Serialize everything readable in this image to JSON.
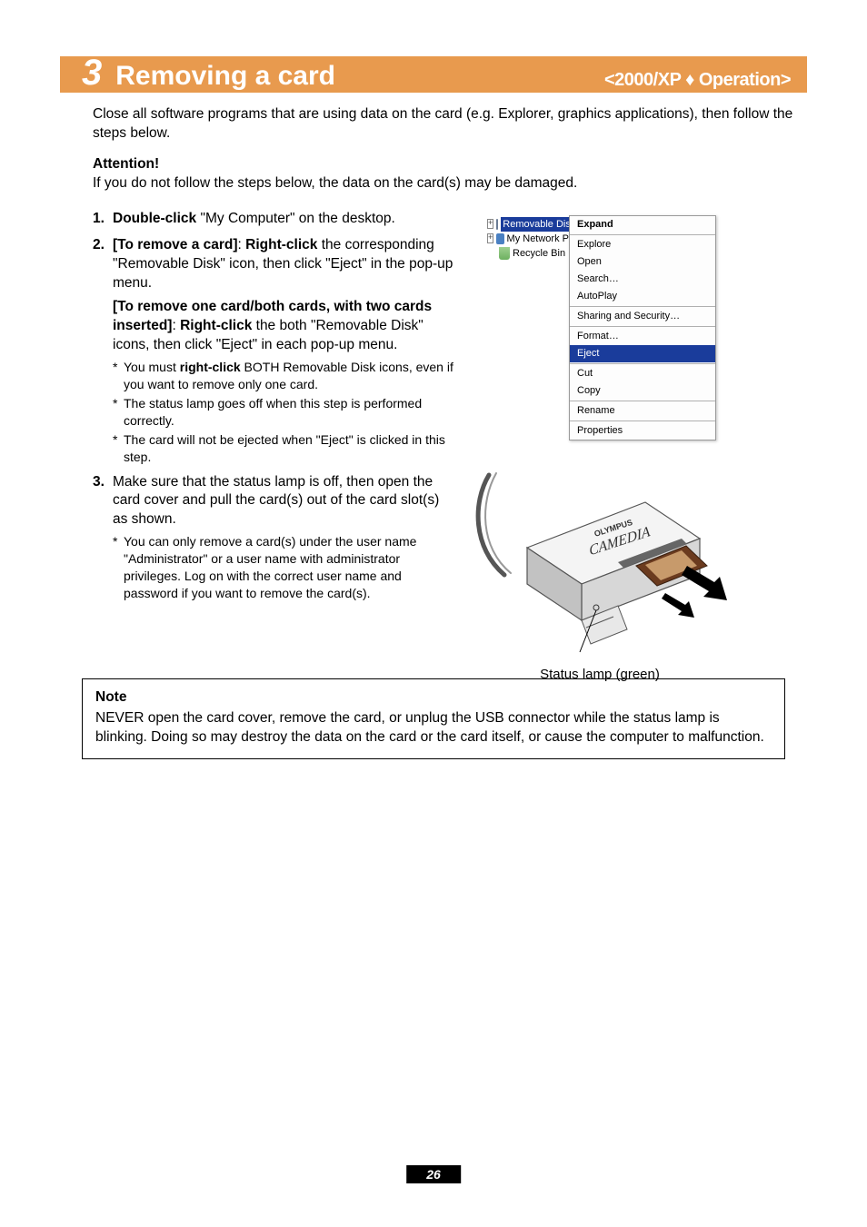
{
  "banner": {
    "number": "3",
    "title": "Removing a card",
    "right": "<2000/XP ♦ Operation>"
  },
  "intro": "Close all software programs that are using data on the card (e.g. Explorer, graphics applications), then follow the steps below.",
  "attention": {
    "heading": "Attention!",
    "text": "If you do not follow the steps below, the data on the card(s) may be damaged."
  },
  "steps": {
    "s1": {
      "bold": "Double-click",
      "rest": " \"My Computer\" on the desktop."
    },
    "s2": {
      "lead_bold1": "[To remove a card]",
      "lead_sep": ": ",
      "lead_bold2": "Right-click",
      "lead_rest": " the corresponding \"Removable Disk\" icon, then click \"Eject\" in the pop-up menu.",
      "sub_bold1": "[To remove one card/both cards, with two cards inserted]",
      "sub_sep": ": ",
      "sub_bold2": "Right-click",
      "sub_rest": " the both \"Removable Disk\" icons, then click \"Eject\" in each pop-up menu.",
      "stars": [
        {
          "pre": "You must ",
          "bold": "right-click",
          "post": " BOTH Removable Disk icons, even if you want to remove only one card."
        },
        {
          "pre": "The status lamp goes off when this step is performed correctly.",
          "bold": "",
          "post": ""
        },
        {
          "pre": "The card will not be ejected when \"Eject\" is clicked in this step.",
          "bold": "",
          "post": ""
        }
      ]
    },
    "s3": {
      "text": "Make sure that the status lamp is off, then open the card cover and pull the card(s) out of the card slot(s) as shown.",
      "stars": [
        {
          "pre": "You can only remove a card(s) under the user name \"Administrator\" or a user name with administrator privileges. Log on with the correct user name and password if you want to remove the card(s).",
          "bold": "",
          "post": ""
        }
      ]
    }
  },
  "tree": {
    "removable": "Removable Disk (…)",
    "network": "My Network P",
    "recycle": "Recycle Bin"
  },
  "context_menu": [
    {
      "label": "Expand",
      "bold": true
    },
    {
      "sep": true
    },
    {
      "label": "Explore"
    },
    {
      "label": "Open"
    },
    {
      "label": "Search…"
    },
    {
      "label": "AutoPlay"
    },
    {
      "sep": true
    },
    {
      "label": "Sharing and Security…"
    },
    {
      "sep": true
    },
    {
      "label": "Format…"
    },
    {
      "label": "Eject",
      "highlight": true
    },
    {
      "sep": true
    },
    {
      "label": "Cut"
    },
    {
      "label": "Copy"
    },
    {
      "sep": true
    },
    {
      "label": "Rename"
    },
    {
      "sep": true
    },
    {
      "label": "Properties"
    }
  ],
  "device": {
    "brand1": "OLYMPUS",
    "brand2": "CAMEDIA",
    "caption": "Status lamp (green)"
  },
  "note": {
    "heading": "Note",
    "text": "NEVER open the card cover, remove the card, or unplug the USB connector while the status lamp is blinking. Doing so may destroy the data on the card or the card itself, or cause the computer to malfunction."
  },
  "page_number": "26"
}
